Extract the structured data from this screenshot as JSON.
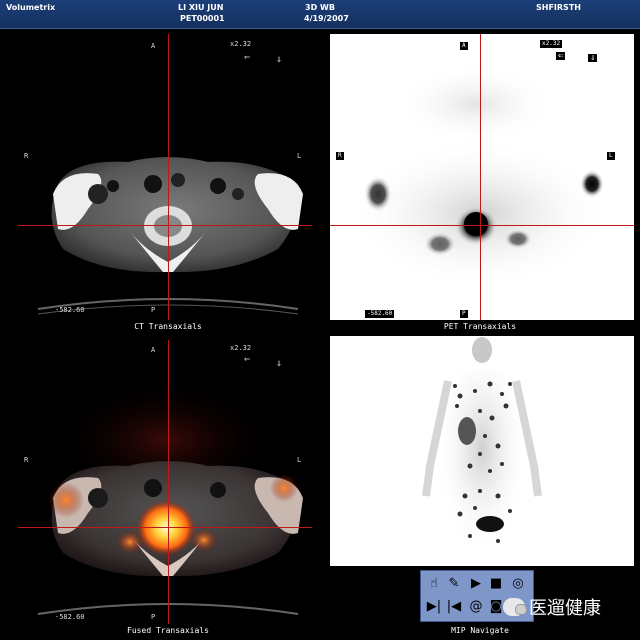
{
  "header": {
    "app": "Volumetrix",
    "patient_name": "LI XIU JUN",
    "patient_id": "PET00001",
    "study": "3D WB",
    "date": "4/19/2007",
    "user": "SHFIRSTH"
  },
  "ct": {
    "anterior": "A",
    "posterior": "P",
    "right": "R",
    "left": "L",
    "zoom": "x2.32",
    "arrow_left": "⇐",
    "arrow_down": "⇓",
    "position": "-582.60",
    "caption": "CT Transaxials"
  },
  "pet": {
    "anterior": "A",
    "posterior": "P",
    "right": "R",
    "left": "L",
    "zoom": "x2.32",
    "arrow_left": "⇐",
    "arrow_down": "⇓",
    "position": "-582.60",
    "caption": "PET Transaxials"
  },
  "fused": {
    "anterior": "A",
    "posterior": "P",
    "right": "R",
    "left": "L",
    "zoom": "x2.32",
    "arrow_left": "⇐",
    "arrow_down": "⇓",
    "position": "-582.60",
    "caption": "Fused Transaxials"
  },
  "mip": {
    "caption": "MIP Navigate"
  },
  "toolbar": {
    "icons": [
      "hand-select-icon",
      "pen-icon",
      "play-icon",
      "stop-icon",
      "target-icon",
      "skip-forward-icon",
      "skip-back-icon",
      "spiral-icon",
      "camera-icon",
      "record-icon"
    ]
  },
  "watermark": "医遛健康",
  "colors": {
    "header_bg": "#1c3f78",
    "crosshair": "#c01818",
    "toolbar_bg": "#7f97c8"
  }
}
